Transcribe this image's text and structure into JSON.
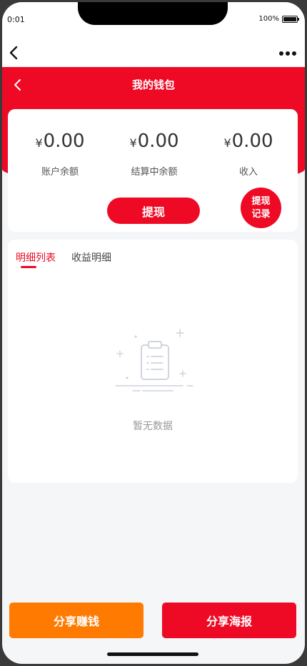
{
  "status_bar": {
    "time": "0:01",
    "battery": "100%"
  },
  "header": {
    "title": "我的钱包"
  },
  "balance": {
    "currency_symbol": "¥",
    "stats": [
      {
        "value": "0.00",
        "label": "账户余额"
      },
      {
        "value": "0.00",
        "label": "结算中余额"
      },
      {
        "value": "0.00",
        "label": "收入"
      }
    ],
    "withdraw_label": "提现",
    "record_label_line1": "提现",
    "record_label_line2": "记录"
  },
  "details": {
    "tabs": [
      {
        "label": "明细列表",
        "active": true
      },
      {
        "label": "收益明细",
        "active": false
      }
    ],
    "empty_text": "暂无数据"
  },
  "footer": {
    "share_earn_label": "分享赚钱",
    "share_poster_label": "分享海报"
  },
  "colors": {
    "primary_red": "#ee0a24",
    "orange": "#ff7a00",
    "background": "#f5f6f8"
  },
  "icons": {
    "browser_back": "chevron-left-icon",
    "browser_more": "more-dots-icon",
    "header_back": "chevron-left-icon",
    "empty_state": "clipboard-icon"
  }
}
